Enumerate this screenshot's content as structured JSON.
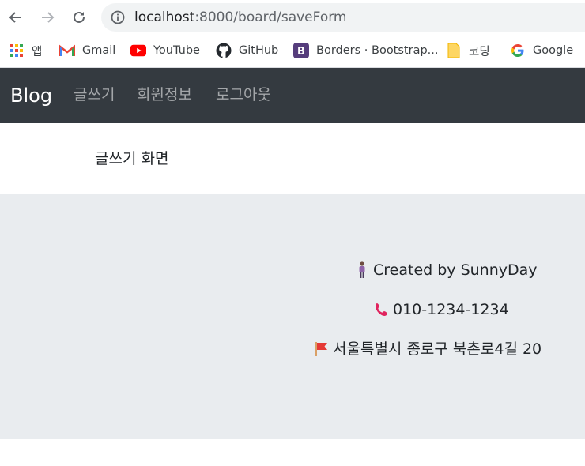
{
  "browser": {
    "url_host": "localhost",
    "url_path": ":8000/board/saveForm",
    "bookmarks": [
      {
        "label": "앱",
        "icon": "apps-grid-icon"
      },
      {
        "label": "Gmail",
        "icon": "gmail-icon"
      },
      {
        "label": "YouTube",
        "icon": "youtube-icon"
      },
      {
        "label": "GitHub",
        "icon": "github-icon"
      },
      {
        "label": "Borders · Bootstrap...",
        "icon": "bootstrap-icon"
      },
      {
        "label": "코딩",
        "icon": "folder-icon"
      },
      {
        "label": "Google",
        "icon": "google-icon"
      }
    ]
  },
  "navbar": {
    "brand": "Blog",
    "links": [
      "글쓰기",
      "회원정보",
      "로그아웃"
    ]
  },
  "main": {
    "title": "글쓰기 화면"
  },
  "footer": {
    "created_by": "Created by SunnyDay",
    "phone": "010-1234-1234",
    "address": "서울특별시 종로구 북촌로4길 20"
  },
  "colors": {
    "navbar_bg": "#343a40",
    "footer_bg": "#e9ecef"
  }
}
